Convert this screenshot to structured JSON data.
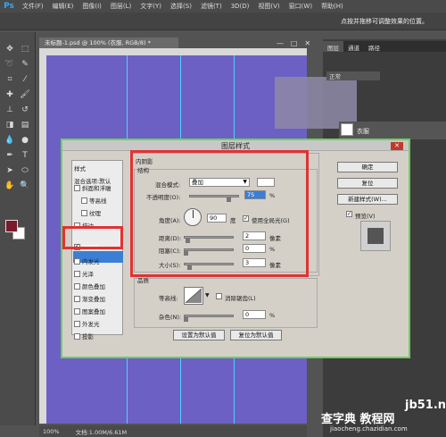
{
  "menubar": {
    "logo": "Ps",
    "items": [
      "文件(F)",
      "编辑(E)",
      "图像(I)",
      "图层(L)",
      "文字(Y)",
      "选择(S)",
      "滤镜(T)",
      "3D(D)",
      "视图(V)",
      "窗口(W)",
      "帮助(H)"
    ]
  },
  "options": {
    "hint": "点按并拖移可调整效果的位置。"
  },
  "document": {
    "tab_title": "未标题-1.psd @ 100% (衣服, RGB/8) *",
    "controls": [
      "—",
      "□",
      "✕"
    ],
    "zoom": "100%",
    "doc_info": "文档:1.00M/6.61M"
  },
  "right_panel": {
    "tabs": [
      "图层",
      "通道",
      "路径"
    ],
    "blend_mode": "正常",
    "layer_name": "衣服"
  },
  "dialog": {
    "title": "图层样式",
    "styles_header": "样式",
    "blend_options": "混合选项:默认",
    "style_items": [
      {
        "label": "斜面和浮雕",
        "checked": false
      },
      {
        "label": "等高线",
        "checked": false
      },
      {
        "label": "纹理",
        "checked": false
      },
      {
        "label": "描边",
        "checked": false
      },
      {
        "label": "内阴影",
        "checked": true
      },
      {
        "label": "内发光",
        "checked": false
      },
      {
        "label": "光泽",
        "checked": false
      },
      {
        "label": "颜色叠加",
        "checked": false
      },
      {
        "label": "渐变叠加",
        "checked": false
      },
      {
        "label": "图案叠加",
        "checked": false
      },
      {
        "label": "外发光",
        "checked": false
      },
      {
        "label": "投影",
        "checked": false
      }
    ],
    "section_title": "内阴影",
    "structure_title": "结构",
    "blend_mode_label": "混合模式:",
    "blend_mode_value": "叠加",
    "opacity_label": "不透明度(O):",
    "opacity_value": "75",
    "percent": "%",
    "angle_label": "角度(A):",
    "angle_value": "90",
    "angle_unit": "度",
    "global_light_label": "使用全局光(G)",
    "global_light_checked": true,
    "distance_label": "距离(D):",
    "distance_value": "2",
    "choke_label": "阻塞(C):",
    "choke_value": "0",
    "size_label": "大小(S):",
    "size_value": "3",
    "px_unit": "像素",
    "quality_title": "品质",
    "contour_label": "等高线:",
    "antialias_label": "消除锯齿(L)",
    "noise_label": "杂色(N):",
    "noise_value": "0",
    "set_default": "设置为默认值",
    "reset_default": "复位为默认值",
    "ok_button": "确定",
    "reset_button": "复位",
    "new_style_button": "新建样式(W)...",
    "preview_label": "预览(V)",
    "preview_checked": true
  },
  "watermark": {
    "site": "jb51.net",
    "line1": "查字典 教程网",
    "line2": "jiaocheng.chazidian.com"
  },
  "colors": {
    "canvas": "#6c60c4",
    "foreground": "#7b1a2a",
    "highlight": "#3a7fd5",
    "annotation": "#e23232",
    "dialog_border": "#6bd15d"
  }
}
